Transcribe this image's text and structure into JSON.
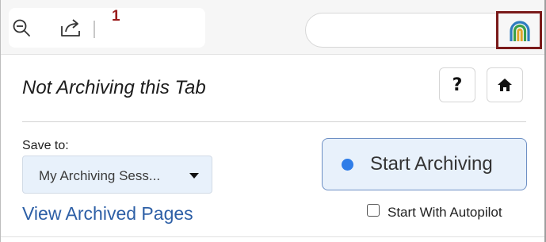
{
  "toolbar": {
    "zoom_icon": "zoom-out-icon",
    "share_icon": "share-icon",
    "badge_count": "1",
    "extension_icon": "archive-arch-logo-icon"
  },
  "popup": {
    "status_title": "Not Archiving this Tab",
    "help_label": "?",
    "home_icon": "home-icon",
    "save_to_label": "Save to:",
    "collection_value": "My Archiving Sess...",
    "view_link": "View Archived Pages",
    "start_button_label": "Start Archiving",
    "autopilot_label": "Start With Autopilot",
    "autopilot_checked": false
  },
  "colors": {
    "accent_blue": "#2f7de8",
    "link_blue": "#2d5fa6",
    "badge_red": "#9b1c1c",
    "highlight_border": "#7a1a1a",
    "button_bg": "#e8f1fb"
  }
}
